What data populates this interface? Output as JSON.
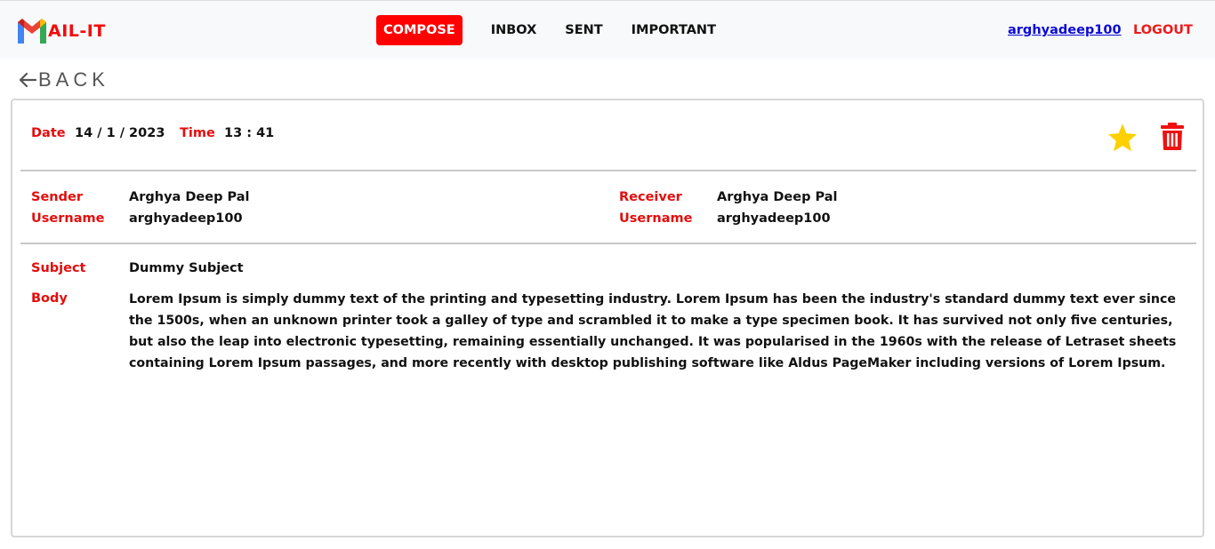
{
  "app": {
    "name": "AIL-IT",
    "logo_letter": "M"
  },
  "nav": {
    "compose": "COMPOSE",
    "inbox": "INBOX",
    "sent": "SENT",
    "important": "IMPORTANT",
    "username": "arghyadeep100",
    "logout": "LOGOUT"
  },
  "back": {
    "label": "BACK",
    "icon": "arrow-left-icon"
  },
  "mail": {
    "date_label": "Date",
    "date_value": "14 / 1 / 2023",
    "time_label": "Time",
    "time_value": "13 : 41",
    "actions": {
      "star_icon": "star-icon",
      "delete_icon": "trash-icon"
    },
    "sender": {
      "label": "Sender",
      "name": "Arghya Deep Pal",
      "username_label": "Username",
      "username": "arghyadeep100"
    },
    "receiver": {
      "label": "Receiver",
      "name": "Arghya Deep Pal",
      "username_label": "Username",
      "username": "arghyadeep100"
    },
    "subject_label": "Subject",
    "subject": "Dummy Subject",
    "body_label": "Body",
    "body": "Lorem Ipsum is simply dummy text of the printing and typesetting industry. Lorem Ipsum has been the industry's standard dummy text ever since the 1500s, when an unknown printer took a galley of type and scrambled it to make a type specimen book. It has survived not only five centuries, but also the leap into electronic typesetting, remaining essentially unchanged. It was popularised in the 1960s with the release of Letraset sheets containing Lorem Ipsum passages, and more recently with desktop publishing software like Aldus PageMaker including versions of Lorem Ipsum."
  },
  "colors": {
    "accent": "#ff0000",
    "label": "#e30d0d",
    "star": "#ffd000",
    "link": "#0b0bd8"
  }
}
